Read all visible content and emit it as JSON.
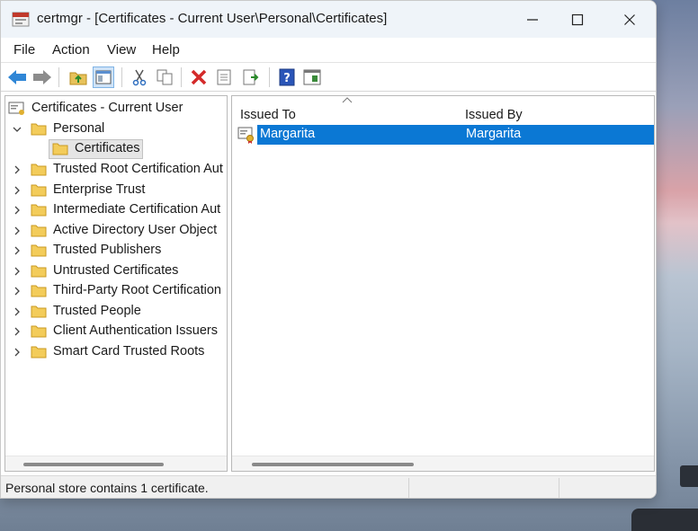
{
  "window": {
    "title": "certmgr - [Certificates - Current User\\Personal\\Certificates]"
  },
  "menu": {
    "items": [
      "File",
      "Action",
      "View",
      "Help"
    ]
  },
  "toolbar": {
    "buttons": [
      "back-arrow-icon",
      "forward-arrow-icon",
      "up-folder-icon",
      "show-hide-tree-icon",
      "cut-icon",
      "copy-icon",
      "delete-icon",
      "properties-icon",
      "export-icon",
      "help-icon",
      "console-icon"
    ]
  },
  "tree": {
    "root": "Certificates - Current User",
    "personal": "Personal",
    "selected": "Certificates",
    "items": [
      "Trusted Root Certification Aut",
      "Enterprise Trust",
      "Intermediate Certification Aut",
      "Active Directory User Object",
      "Trusted Publishers",
      "Untrusted Certificates",
      "Third-Party Root Certification",
      "Trusted People",
      "Client Authentication Issuers",
      "Smart Card Trusted Roots"
    ]
  },
  "list": {
    "columns": [
      "Issued To",
      "Issued By"
    ],
    "rows": [
      {
        "issued_to": "Margarita",
        "issued_by": "Margarita"
      }
    ]
  },
  "status": {
    "text": "Personal store contains 1 certificate."
  },
  "colors": {
    "selection": "#0b78d4",
    "titlebar": "#eff4f9"
  }
}
